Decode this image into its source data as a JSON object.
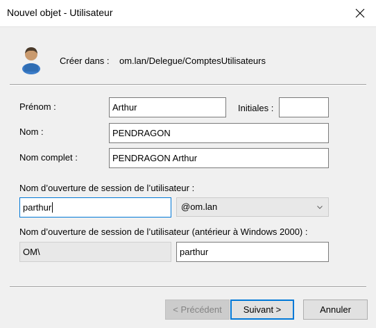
{
  "window": {
    "title": "Nouvel objet - Utilisateur",
    "close_icon": "close-icon"
  },
  "header": {
    "icon": "user-icon",
    "create_in_label": "Créer dans :",
    "create_in_path": "om.lan/Delegue/ComptesUtilisateurs"
  },
  "form": {
    "first_name_label": "Prénom :",
    "first_name_value": "Arthur",
    "initials_label": "Initiales :",
    "initials_value": "",
    "last_name_label": "Nom :",
    "last_name_value": "PENDRAGON",
    "full_name_label": "Nom complet :",
    "full_name_value": "PENDRAGON Arthur",
    "logon_name_label": "Nom d’ouverture de session de l’utilisateur :",
    "logon_name_value": "parthur",
    "domain_suffix": "@om.lan",
    "logon_pre2000_label": "Nom d’ouverture de session de l’utilisateur (antérieur à Windows 2000) :",
    "netbios_domain": "OM\\",
    "logon_pre2000_value": "parthur"
  },
  "buttons": {
    "previous": "< Précédent",
    "next": "Suivant >",
    "cancel": "Annuler"
  },
  "colors": {
    "accent": "#0078d7",
    "dialog_bg": "#f0f0f0"
  }
}
